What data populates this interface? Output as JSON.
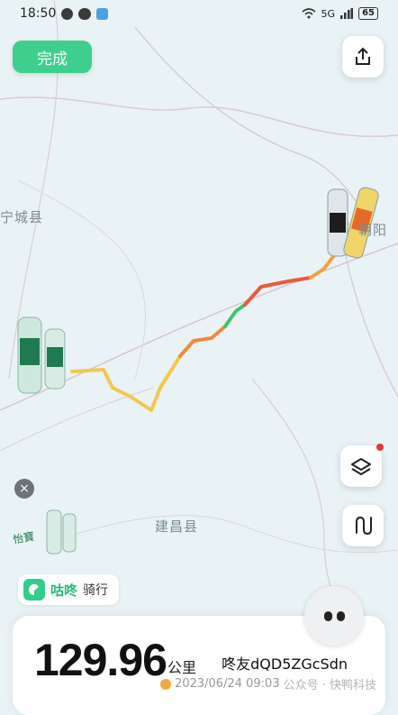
{
  "status_bar": {
    "time": "18:50",
    "network": "5G",
    "battery": "65",
    "icons": [
      "message-icon",
      "chat-icon",
      "photo-icon",
      "wifi-icon",
      "signal-icon",
      "battery-icon"
    ]
  },
  "top": {
    "done_label": "完成",
    "share_icon": "share-icon"
  },
  "map": {
    "place_labels": {
      "ningcheng": "宁城县",
      "jianchang": "建昌县",
      "chaoyang": "朝阳"
    },
    "layers_icon": "layers-icon",
    "route_icon": "route-icon",
    "close_icon": "close-icon"
  },
  "brand": {
    "name": "咕咚",
    "mode": "骑行"
  },
  "summary": {
    "distance": "129.96",
    "unit": "公里",
    "username": "咚友dQD5ZGcSdn",
    "date": "2023/06/24 09:03",
    "watermark": "公众号 · 快鸭科技"
  },
  "colors": {
    "accent": "#3ecf8e",
    "route_yellow": "#f2c84b",
    "route_orange": "#f08a3e",
    "route_red": "#e85a3f",
    "route_green": "#43c26a"
  }
}
